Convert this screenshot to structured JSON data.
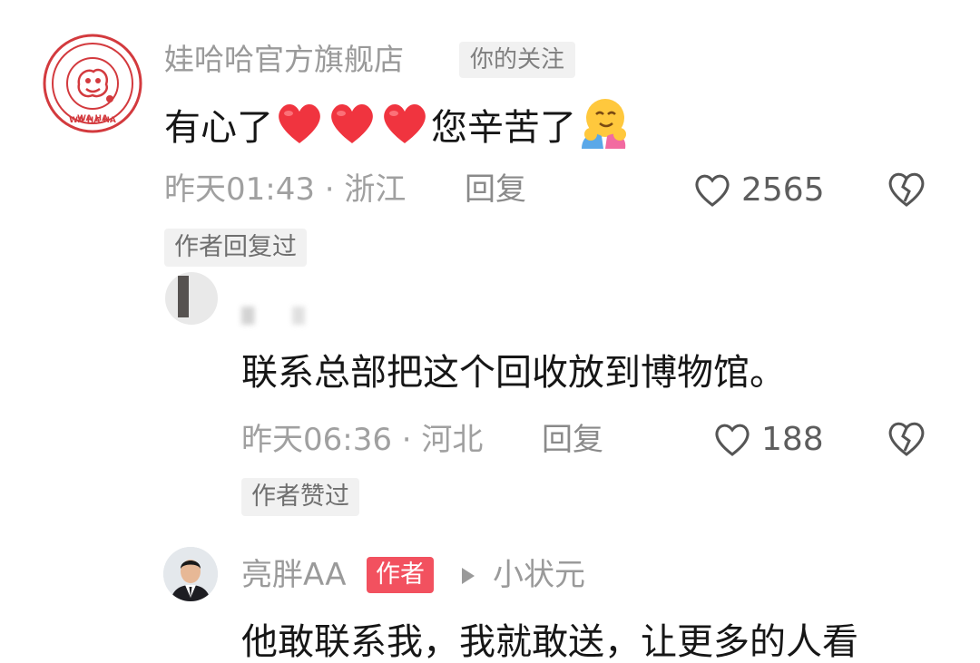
{
  "comments": [
    {
      "username": "娃哈哈官方旗舰店",
      "follow_tag": "你的关注",
      "avatar_text": "WA HA HA",
      "text_before": "有心了",
      "text_after": "您辛苦了",
      "time_location": "昨天01:43 · 浙江",
      "reply_label": "回复",
      "likes": "2565",
      "status_tag": "作者回复过"
    },
    {
      "text": "联系总部把这个回收放到博物馆。",
      "time_location": "昨天06:36 · 河北",
      "reply_label": "回复",
      "likes": "188",
      "status_tag": "作者赞过"
    },
    {
      "username": "亮胖AA",
      "author_badge": "作者",
      "reply_to": "小状元",
      "text": "他敢联系我，我就敢送，让更多的人看"
    }
  ],
  "colors": {
    "heart_red": "#f0343f",
    "author_badge_bg": "#f2515f",
    "muted_text": "#9a9a9a",
    "tag_bg": "#f1f1f1"
  },
  "icons": {
    "like": "heart-outline-icon",
    "dislike": "broken-heart-icon",
    "reply_arrow": "right-triangle-icon",
    "emoji_heart": "red-heart-emoji",
    "emoji_hug": "hugging-face-emoji"
  }
}
